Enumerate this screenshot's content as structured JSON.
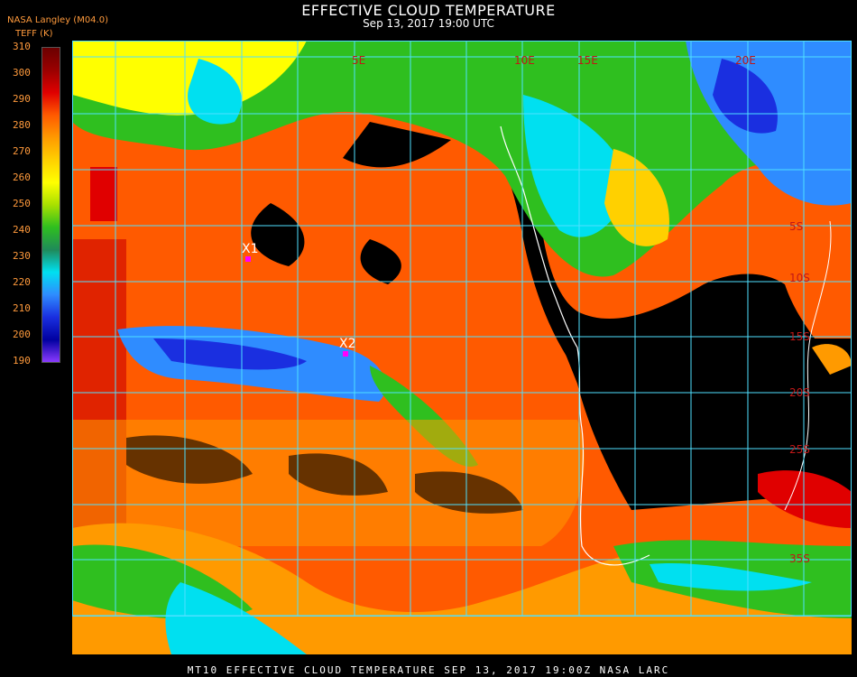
{
  "header": {
    "title": "EFFECTIVE CLOUD TEMPERATURE",
    "subtitle": "Sep 13, 2017 19:00 UTC",
    "org": "NASA Langley (M04.0)",
    "unit": "TEFF (K)"
  },
  "legend": {
    "ticks": [
      "310",
      "300",
      "290",
      "280",
      "270",
      "260",
      "250",
      "240",
      "230",
      "220",
      "210",
      "200",
      "190"
    ],
    "colors": [
      "#6b0000",
      "#9a0000",
      "#e00000",
      "#ff5a00",
      "#ff9a00",
      "#ffd000",
      "#ffff00",
      "#a8e000",
      "#2fbf1f",
      "#1f8a5a",
      "#00e0f0",
      "#2f8cff",
      "#1a2fe0",
      "#0000a0",
      "#8a3aff"
    ]
  },
  "map": {
    "lat_labels": [
      "5S",
      "10S",
      "15S",
      "20S",
      "25S",
      "35S"
    ],
    "lon_labels": [
      "5E",
      "10E",
      "15E",
      "20E"
    ],
    "markers": [
      {
        "label": "X1"
      },
      {
        "label": "X2"
      }
    ],
    "grid_color": "#4fe0ff",
    "coast_color": "#ffffff"
  },
  "footer": "MT10  EFFECTIVE CLOUD TEMPERATURE   SEP 13, 2017 19:00Z   NASA LARC"
}
